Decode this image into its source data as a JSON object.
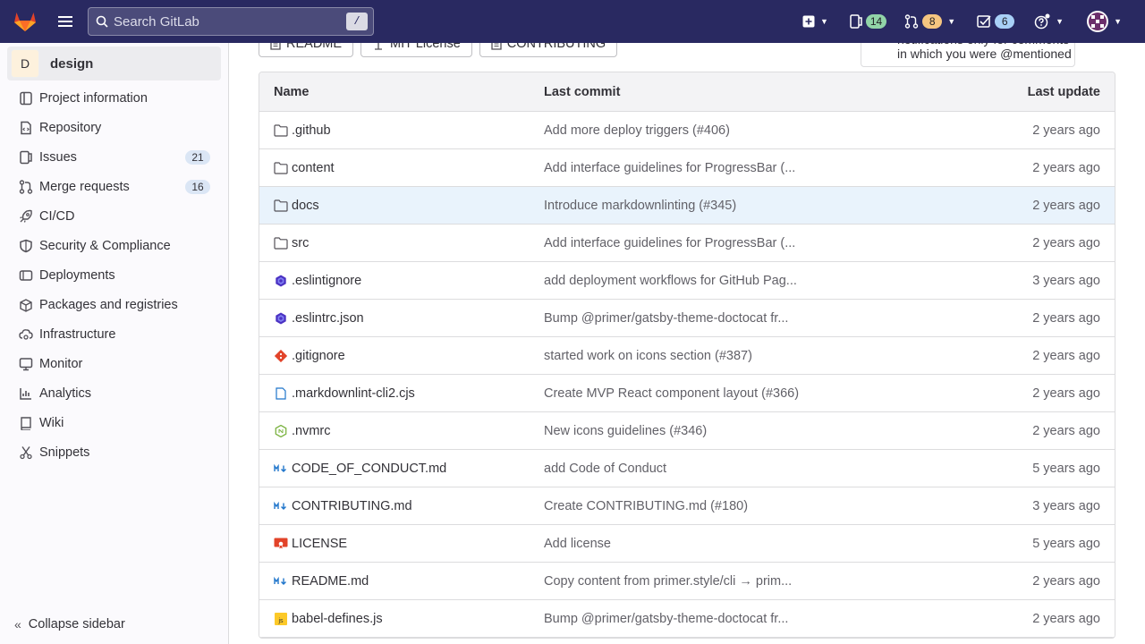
{
  "topbar": {
    "search_placeholder": "Search GitLab",
    "search_shortcut": "/",
    "issues_count": "14",
    "mr_count": "8",
    "todos_count": "6",
    "colors": {
      "bg": "#292961",
      "issues_badge": "#91d4a8",
      "mr_badge": "#f5c580",
      "todos_badge": "#a8d0f7"
    }
  },
  "sidebar": {
    "project_initial": "D",
    "project_name": "design",
    "items": [
      {
        "label": "Project information",
        "icon": "project-icon"
      },
      {
        "label": "Repository",
        "icon": "doc-code-icon"
      },
      {
        "label": "Issues",
        "icon": "issues-icon",
        "count": "21"
      },
      {
        "label": "Merge requests",
        "icon": "merge-request-icon",
        "count": "16"
      },
      {
        "label": "CI/CD",
        "icon": "rocket-icon"
      },
      {
        "label": "Security & Compliance",
        "icon": "shield-icon"
      },
      {
        "label": "Deployments",
        "icon": "deployments-icon"
      },
      {
        "label": "Packages and registries",
        "icon": "package-icon"
      },
      {
        "label": "Infrastructure",
        "icon": "cloud-gear-icon"
      },
      {
        "label": "Monitor",
        "icon": "monitor-icon"
      },
      {
        "label": "Analytics",
        "icon": "chart-icon"
      },
      {
        "label": "Wiki",
        "icon": "book-icon"
      },
      {
        "label": "Snippets",
        "icon": "snippet-icon"
      }
    ],
    "collapse_label": "Collapse sidebar"
  },
  "main": {
    "buttons": [
      {
        "label": "README",
        "icon": "doc-icon"
      },
      {
        "label": "MIT License",
        "icon": "scale-icon"
      },
      {
        "label": "CONTRIBUTING",
        "icon": "doc-icon"
      }
    ],
    "notification_text": "notifications only for comments in which you were @mentioned",
    "table": {
      "headers": {
        "name": "Name",
        "commit": "Last commit",
        "date": "Last update"
      },
      "rows": [
        {
          "name": ".github",
          "type": "folder",
          "commit": "Add more deploy triggers (#406)",
          "date": "2 years ago"
        },
        {
          "name": "content",
          "type": "folder",
          "commit": "Add interface guidelines for ProgressBar (...",
          "date": "2 years ago"
        },
        {
          "name": "docs",
          "type": "folder",
          "commit": "Introduce markdownlinting (#345)",
          "date": "2 years ago",
          "selected": true
        },
        {
          "name": "src",
          "type": "folder",
          "commit": "Add interface guidelines for ProgressBar (...",
          "date": "2 years ago"
        },
        {
          "name": ".eslintignore",
          "type": "eslint",
          "commit": "add deployment workflows for GitHub Pag...",
          "date": "3 years ago"
        },
        {
          "name": ".eslintrc.json",
          "type": "eslint",
          "commit": "Bump @primer/gatsby-theme-doctocat fr...",
          "date": "2 years ago"
        },
        {
          "name": ".gitignore",
          "type": "git",
          "commit": "started work on icons section (#387)",
          "date": "2 years ago"
        },
        {
          "name": ".markdownlint-cli2.cjs",
          "type": "file",
          "commit": "Create MVP React component layout (#366)",
          "date": "2 years ago"
        },
        {
          "name": ".nvmrc",
          "type": "node",
          "commit": "New icons guidelines (#346)",
          "date": "2 years ago"
        },
        {
          "name": "CODE_OF_CONDUCT.md",
          "type": "markdown",
          "commit": "add Code of Conduct",
          "date": "5 years ago"
        },
        {
          "name": "CONTRIBUTING.md",
          "type": "markdown",
          "commit": "Create CONTRIBUTING.md (#180)",
          "date": "3 years ago"
        },
        {
          "name": "LICENSE",
          "type": "license",
          "commit": "Add license",
          "date": "5 years ago"
        },
        {
          "name": "README.md",
          "type": "markdown",
          "commit": "Copy content from primer.style/cli → prim...",
          "date": "2 years ago"
        },
        {
          "name": "babel-defines.js",
          "type": "js",
          "commit": "Bump @primer/gatsby-theme-doctocat fr...",
          "date": "2 years ago"
        }
      ]
    }
  }
}
